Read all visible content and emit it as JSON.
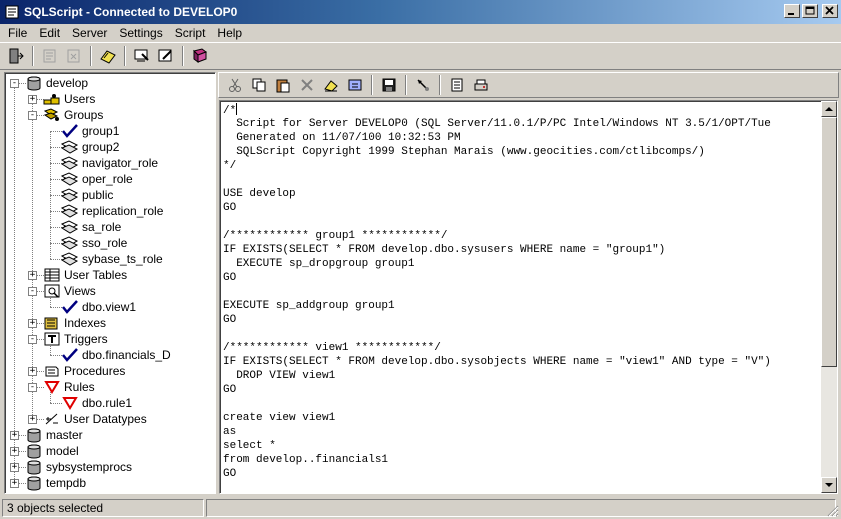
{
  "window": {
    "title": "SQLScript - Connected to DEVELOP0"
  },
  "menu": [
    "File",
    "Edit",
    "Server",
    "Settings",
    "Script",
    "Help"
  ],
  "tree": [
    {
      "label": "develop",
      "icon": "database-icon",
      "x": 0,
      "y": 0
    },
    {
      "label": "Users",
      "icon": "users-icon",
      "x": 1,
      "y": 1
    },
    {
      "label": "Groups",
      "icon": "groups-icon",
      "x": 1,
      "y": 2
    },
    {
      "label": "group1",
      "icon": "checkmark-icon",
      "x": 2,
      "y": 3
    },
    {
      "label": "group2",
      "icon": "group-icon",
      "x": 2,
      "y": 4
    },
    {
      "label": "navigator_role",
      "icon": "group-icon",
      "x": 2,
      "y": 5
    },
    {
      "label": "oper_role",
      "icon": "group-icon",
      "x": 2,
      "y": 6
    },
    {
      "label": "public",
      "icon": "group-icon",
      "x": 2,
      "y": 7
    },
    {
      "label": "replication_role",
      "icon": "group-icon",
      "x": 2,
      "y": 8
    },
    {
      "label": "sa_role",
      "icon": "group-icon",
      "x": 2,
      "y": 9
    },
    {
      "label": "sso_role",
      "icon": "group-icon",
      "x": 2,
      "y": 10
    },
    {
      "label": "sybase_ts_role",
      "icon": "group-icon",
      "x": 2,
      "y": 11
    },
    {
      "label": "User Tables",
      "icon": "table-icon",
      "x": 1,
      "y": 12
    },
    {
      "label": "Views",
      "icon": "view-icon",
      "x": 1,
      "y": 13
    },
    {
      "label": "dbo.view1",
      "icon": "checkmark-icon",
      "x": 2,
      "y": 14
    },
    {
      "label": "Indexes",
      "icon": "index-icon",
      "x": 1,
      "y": 15
    },
    {
      "label": "Triggers",
      "icon": "trigger-icon",
      "x": 1,
      "y": 16
    },
    {
      "label": "dbo.financials_D",
      "icon": "checkmark-icon",
      "x": 2,
      "y": 17
    },
    {
      "label": "Procedures",
      "icon": "procedure-icon",
      "x": 1,
      "y": 18
    },
    {
      "label": "Rules",
      "icon": "rule-icon",
      "x": 1,
      "y": 19
    },
    {
      "label": "dbo.rule1",
      "icon": "rule-icon",
      "x": 2,
      "y": 20
    },
    {
      "label": "User Datatypes",
      "icon": "datatype-icon",
      "x": 1,
      "y": 21
    },
    {
      "label": "master",
      "icon": "database-icon",
      "x": 0,
      "y": 22
    },
    {
      "label": "model",
      "icon": "database-icon",
      "x": 0,
      "y": 23
    },
    {
      "label": "sybsystemprocs",
      "icon": "database-icon",
      "x": 0,
      "y": 24
    },
    {
      "label": "tempdb",
      "icon": "database-icon",
      "x": 0,
      "y": 25
    }
  ],
  "editor": {
    "lines": [
      "/*",
      "  Script for Server DEVELOP0 (SQL Server/11.0.1/P/PC Intel/Windows NT 3.5/1/OPT/Tue",
      "  Generated on 11/07/100 10:32:53 PM",
      "  SQLScript Copyright 1999 Stephan Marais (www.geocities.com/ctlibcomps/)",
      "*/",
      "",
      "USE develop",
      "GO",
      "",
      "/************ group1 ************/",
      "IF EXISTS(SELECT * FROM develop.dbo.sysusers WHERE name = \"group1\")",
      "  EXECUTE sp_dropgroup group1",
      "GO",
      "",
      "EXECUTE sp_addgroup group1",
      "GO",
      "",
      "/************ view1 ************/",
      "IF EXISTS(SELECT * FROM develop.dbo.sysobjects WHERE name = \"view1\" AND type = \"V\")",
      "  DROP VIEW view1",
      "GO",
      "",
      "create view view1",
      "as",
      "select *",
      "from develop..financials1",
      "GO"
    ]
  },
  "status": {
    "text": "3 objects selected"
  }
}
